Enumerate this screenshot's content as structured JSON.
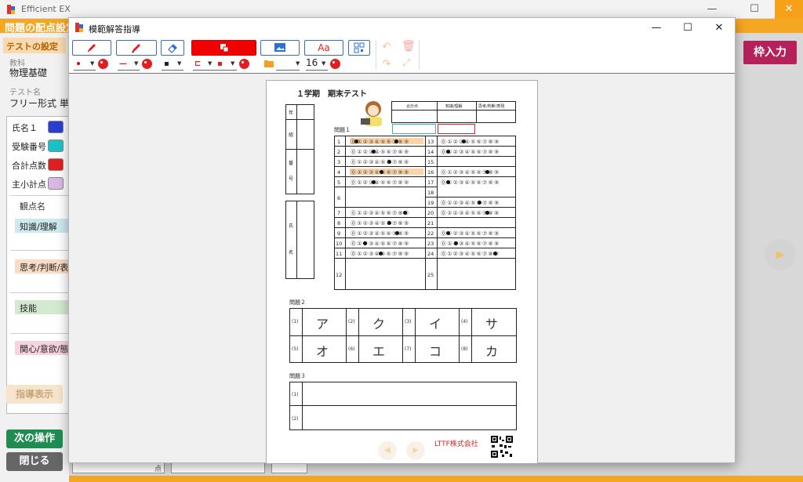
{
  "app": {
    "title": "Efficient EX",
    "section_title": "問題の配点設定",
    "window_controls": {
      "minimize": "—",
      "maximize": "☐",
      "close": "✕"
    }
  },
  "left_panel": {
    "tab": "テストの設定",
    "subject_label": "教科",
    "subject_value": "物理基礎",
    "testname_label": "テスト名",
    "testname_value": "フリー形式 単数",
    "fields": [
      {
        "label": "氏名１",
        "color": "#2a3fd1"
      },
      {
        "label": "受験番号",
        "color": "#19c2c8"
      },
      {
        "label": "合計点数",
        "color": "#e02020"
      },
      {
        "label": "主小計点",
        "color": "#d9b8e6"
      }
    ],
    "view_header": "観点名",
    "views": [
      {
        "label": "知識/理解",
        "color": "#cde9ee"
      },
      {
        "label": "思考/判断/表現",
        "color": "#f9dcc6"
      },
      {
        "label": "技能",
        "color": "#d4ead0"
      },
      {
        "label": "関心/意欲/態度",
        "color": "#f6d3df"
      }
    ],
    "guide_button": "指導表示",
    "next_button": "次の操作",
    "close_button": "閉じる"
  },
  "right": {
    "frame_input_button": "枠入力",
    "bottom_unit": "点"
  },
  "dialog": {
    "title": "模範解答指導",
    "toolbar": {
      "pen_size": "1",
      "line_width": "1",
      "eraser_size": "1",
      "font_size": "16",
      "text_button": "Aa"
    },
    "paper": {
      "heading": "１学期　期末テスト",
      "score_headers": [
        "合計点",
        "知識/理解",
        "思考/判断/表現"
      ],
      "label_nen": "年",
      "label_kumi": "組",
      "label_ban": "番",
      "label_go": "号",
      "label_shi": "氏",
      "label_mei": "名",
      "q1_title": "問題１",
      "q1_left_numbers": [
        "1",
        "2",
        "3",
        "4",
        "5",
        "6",
        "7",
        "8",
        "9",
        "10",
        "11",
        "12"
      ],
      "q1_right_numbers": [
        "13",
        "14",
        "15",
        "16",
        "17",
        "18",
        "19",
        "20",
        "21",
        "22",
        "23",
        "24",
        "25"
      ],
      "q2_title": "問題２",
      "q2_cells": [
        {
          "num": "(1)",
          "char": "ア"
        },
        {
          "num": "(2)",
          "char": "ク"
        },
        {
          "num": "(3)",
          "char": "イ"
        },
        {
          "num": "(4)",
          "char": "サ"
        },
        {
          "num": "(5)",
          "char": "オ"
        },
        {
          "num": "(6)",
          "char": "エ"
        },
        {
          "num": "(7)",
          "char": "コ"
        },
        {
          "num": "(8)",
          "char": "カ"
        }
      ],
      "q3_title": "問題３",
      "q3_rows": [
        "(1)",
        "(2)"
      ],
      "company": "LTTF株式会社",
      "bubble_text": "⓪①②③④⑤⑥⑦⑧⑨"
    }
  }
}
